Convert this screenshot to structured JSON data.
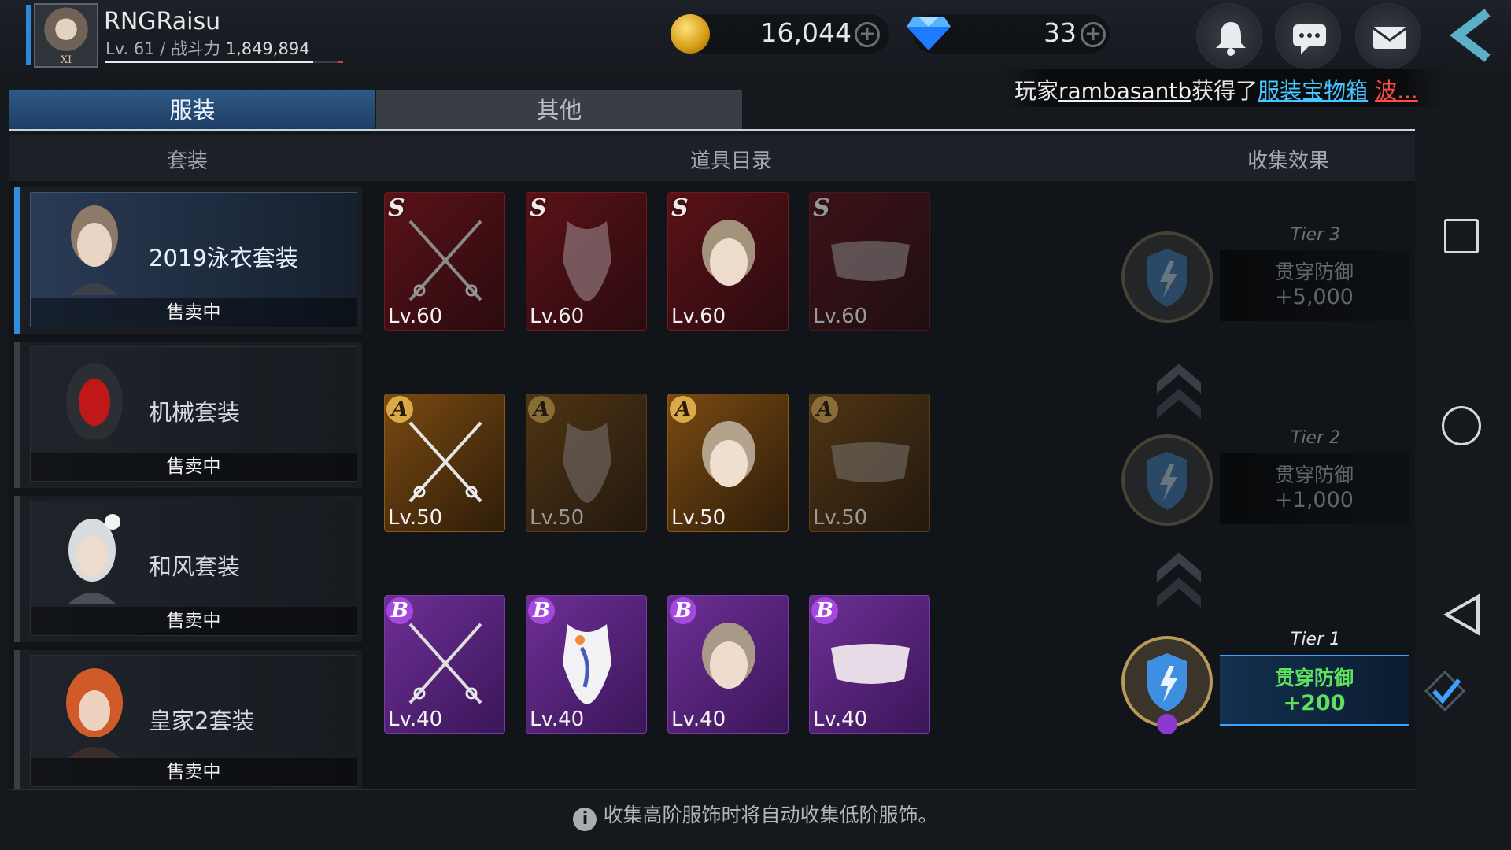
{
  "player": {
    "name": "RNGRaisu",
    "avatar_badge": "XI",
    "level_text": "Lv. 61 / 战斗力 ",
    "power": "1,849,894",
    "exp_percent": 88
  },
  "currency": {
    "gold": "16,044",
    "gems": "33"
  },
  "ticker": {
    "prefix": "玩家",
    "player": "rambasantb",
    "middle": "获得了",
    "item": "服装宝物箱",
    "more": "波..."
  },
  "tabs": {
    "costume": "服装",
    "other": "其他"
  },
  "headers": {
    "set": "套装",
    "items": "道具目录",
    "effect": "收集效果"
  },
  "sets": [
    {
      "name": "2019泳衣套装",
      "status": "售卖中"
    },
    {
      "name": "机械套装",
      "status": "售卖中"
    },
    {
      "name": "和风套装",
      "status": "售卖中"
    },
    {
      "name": "皇家2套装",
      "status": "售卖中"
    }
  ],
  "items": {
    "rows": [
      {
        "grade": "S",
        "cells": [
          "Lv.60",
          "Lv.60",
          "Lv.60",
          "Lv.60"
        ]
      },
      {
        "grade": "A",
        "cells": [
          "Lv.50",
          "Lv.50",
          "Lv.50",
          "Lv.50"
        ]
      },
      {
        "grade": "B",
        "cells": [
          "Lv.40",
          "Lv.40",
          "Lv.40",
          "Lv.40"
        ]
      }
    ]
  },
  "tiers": [
    {
      "label": "Tier 3",
      "stat": "贯穿防御",
      "value": "+5,000",
      "grade": "S"
    },
    {
      "label": "Tier 2",
      "stat": "贯穿防御",
      "value": "+1,000",
      "grade": "A"
    },
    {
      "label": "Tier 1",
      "stat": "贯穿防御",
      "value": "+200",
      "grade": "B"
    }
  ],
  "footer": {
    "note": "收集高阶服饰时将自动收集低阶服饰。"
  },
  "colors": {
    "accent": "#2e8fe0",
    "active_stat": "#5fe05f",
    "ticker_item": "#45c6ff",
    "ticker_more": "#ff4a4a"
  }
}
